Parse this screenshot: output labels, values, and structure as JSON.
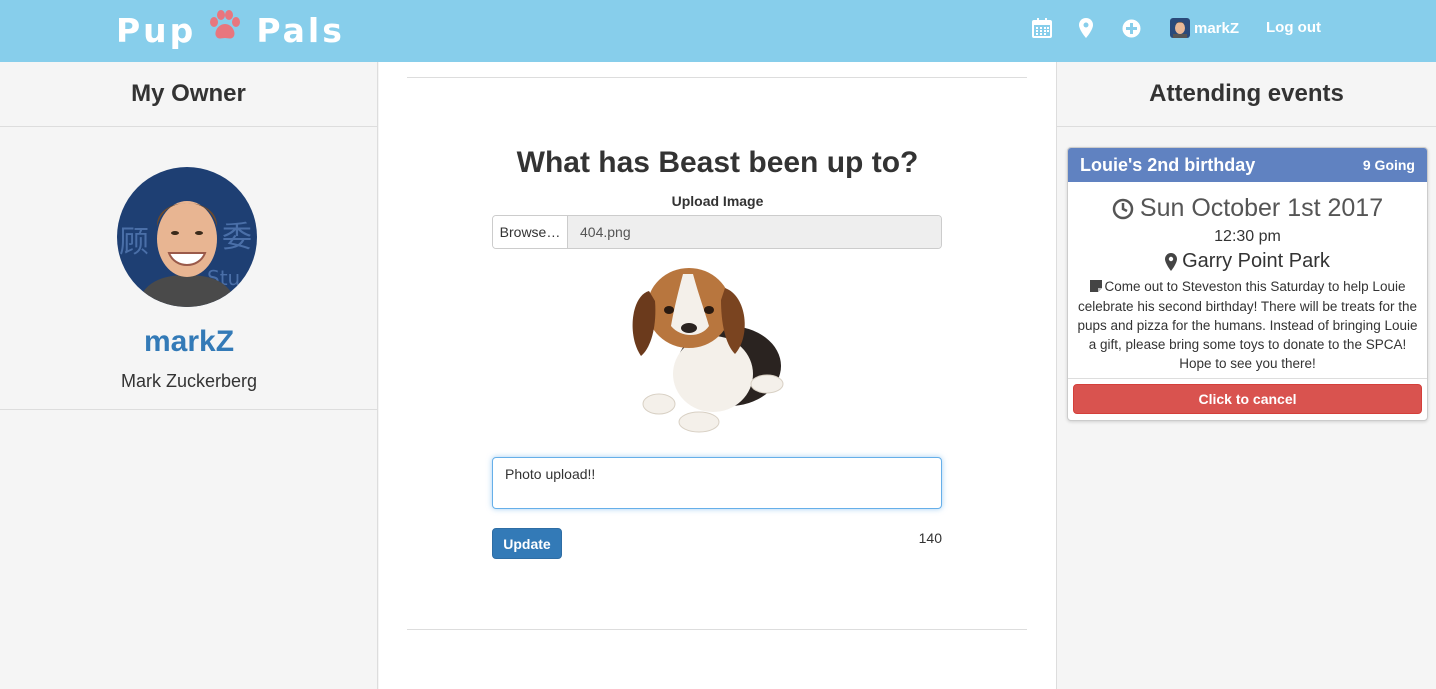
{
  "navbar": {
    "brand_left": "Pup",
    "brand_right": "Pals",
    "brand_icon": "paw-icon",
    "icons": [
      "calendar-icon",
      "map-marker-icon",
      "plus-circle-icon"
    ],
    "username": "markZ",
    "logout_label": "Log out",
    "bg_color": "#87ceeb",
    "paw_color": "#e8767e"
  },
  "left_panel": {
    "heading": "My Owner",
    "username": "markZ",
    "full_name": "Mark Zuckerberg"
  },
  "post_form": {
    "title": "What has Beast been up to?",
    "upload_label": "Upload Image",
    "browse_label": "Browse…",
    "file_name": "404.png",
    "caption_value": "Photo upload!!",
    "update_label": "Update",
    "char_count": "140"
  },
  "right_panel": {
    "heading": "Attending events",
    "events": [
      {
        "title": "Louie's 2nd birthday",
        "going": "9 Going",
        "date": "Sun October 1st 2017",
        "time": "12:30 pm",
        "location": "Garry Point Park",
        "description": "Come out to Steveston this Saturday to help Louie celebrate his second birthday! There will be treats for the pups and pizza for the humans. Instead of bringing Louie a gift, please bring some toys to donate to the SPCA! Hope to see you there!",
        "cancel_label": "Click to cancel",
        "header_color": "#6082c1",
        "cancel_color": "#d9534f"
      }
    ]
  }
}
